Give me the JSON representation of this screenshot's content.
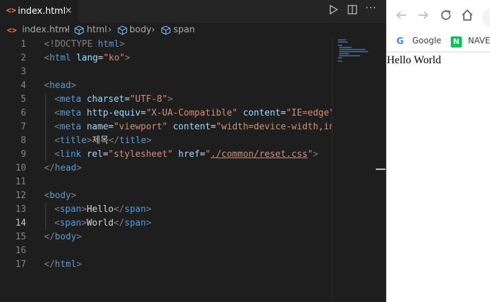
{
  "editor": {
    "tab": {
      "icon": "<>",
      "label": "index.html",
      "close": "×"
    },
    "actions": [
      "run-icon",
      "split-icon",
      "more-icon"
    ],
    "breadcrumb": [
      "index.html",
      "html",
      "body",
      "span"
    ],
    "active_line": 14,
    "lines": [
      {
        "n": "1"
      },
      {
        "n": "2"
      },
      {
        "n": "3"
      },
      {
        "n": "4"
      },
      {
        "n": "5"
      },
      {
        "n": "6"
      },
      {
        "n": "7"
      },
      {
        "n": "8"
      },
      {
        "n": "9"
      },
      {
        "n": "10"
      },
      {
        "n": "11"
      },
      {
        "n": "12"
      },
      {
        "n": "13"
      },
      {
        "n": "14"
      },
      {
        "n": "15"
      },
      {
        "n": "16"
      },
      {
        "n": "17"
      }
    ],
    "code": {
      "l1": [
        "<!DOCTYPE ",
        "html",
        ">"
      ],
      "l2": [
        "<",
        "html",
        " ",
        "lang",
        "=",
        "\"ko\"",
        ">"
      ],
      "l4": [
        "<",
        "head",
        ">"
      ],
      "l5": [
        "<",
        "meta",
        " ",
        "charset",
        "=",
        "\"UTF-8\"",
        ">"
      ],
      "l6": [
        "<",
        "meta",
        " ",
        "http-equiv",
        "=",
        "\"X-UA-Compatible\"",
        " ",
        "content",
        "=",
        "\"IE=edge\"",
        ">"
      ],
      "l7": [
        "<",
        "meta",
        " ",
        "name",
        "=",
        "\"viewport\"",
        " ",
        "content",
        "=",
        "\"width=device-width,init"
      ],
      "l8": [
        "<",
        "title",
        ">",
        "제목",
        "</",
        "title",
        ">"
      ],
      "l9": [
        "<",
        "link",
        " ",
        "rel",
        "=",
        "\"stylesheet\"",
        " ",
        "href",
        "=",
        "\"",
        "./common/reset.css",
        "\"",
        ">"
      ],
      "l10": [
        "</",
        "head",
        ">"
      ],
      "l12": [
        "<",
        "body",
        ">"
      ],
      "l13": [
        "<",
        "span",
        ">",
        "Hello",
        "</",
        "span",
        ">"
      ],
      "l14": [
        "<",
        "span",
        ">",
        "World",
        "</",
        "span",
        ">"
      ],
      "l15": [
        "</",
        "body",
        ">"
      ],
      "l17": [
        "</",
        "html",
        ">"
      ]
    }
  },
  "browser": {
    "bookmarks": [
      {
        "icon": "G",
        "label": "Google"
      },
      {
        "icon": "N",
        "label": "NAVER"
      }
    ],
    "content": "Hello World"
  }
}
